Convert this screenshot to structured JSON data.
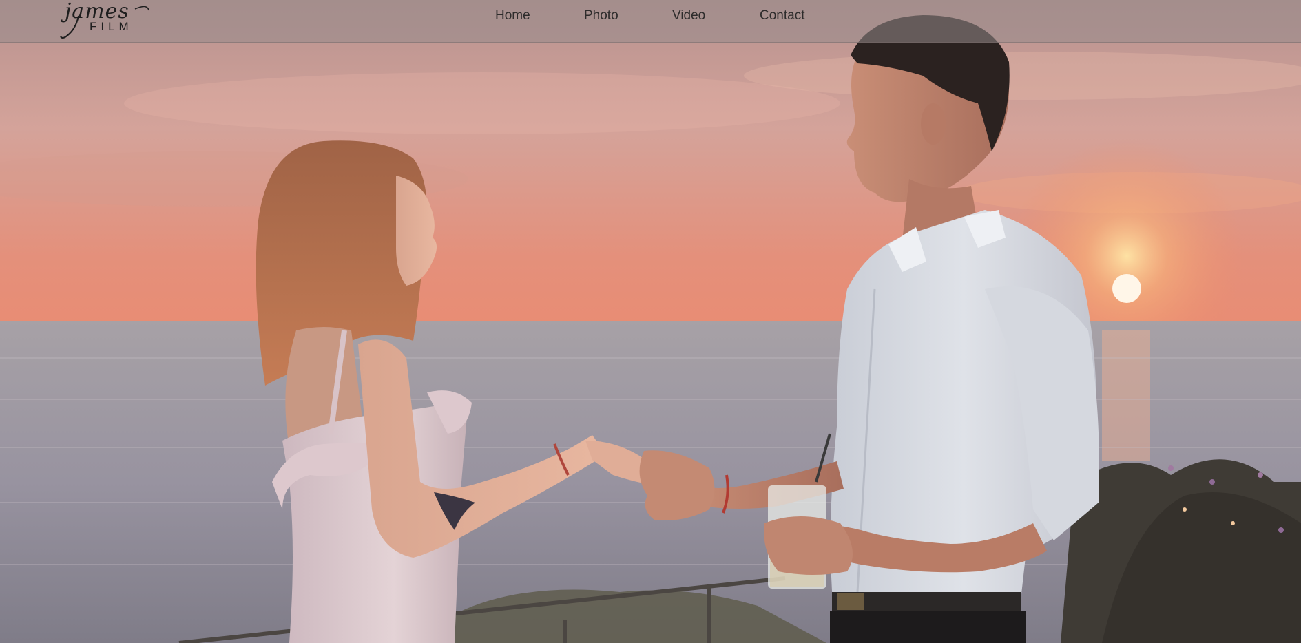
{
  "site": {
    "logo": {
      "script_text": "james",
      "word_text": "FILM"
    },
    "nav": {
      "items": [
        {
          "label": "Home"
        },
        {
          "label": "Photo"
        },
        {
          "label": "Video"
        },
        {
          "label": "Contact"
        }
      ]
    }
  },
  "hero": {
    "photo_subject": "couple-holding-hands-at-sunset"
  },
  "colors": {
    "nav_bar": "#968a8a",
    "nav_text": "#2d2b2b",
    "sky_top": "#c9a19a",
    "sky_mid": "#e39077",
    "horizon": "#f2a07b",
    "sea": "#9e9aa3",
    "sun": "#fff6e8"
  }
}
